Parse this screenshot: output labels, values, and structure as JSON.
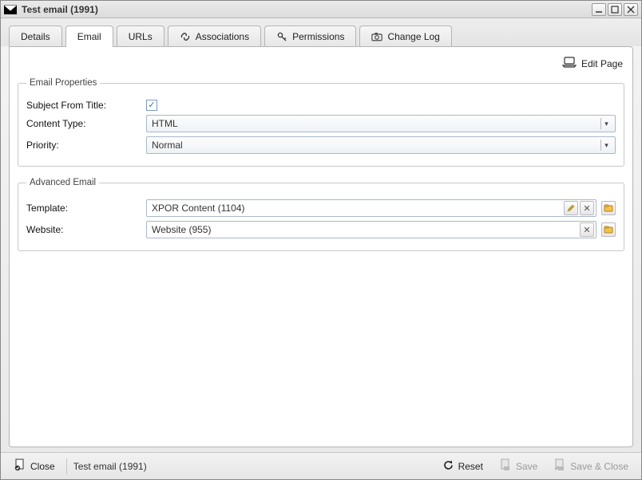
{
  "window": {
    "title": "Test email (1991)"
  },
  "tabs": [
    {
      "label": "Details"
    },
    {
      "label": "Email"
    },
    {
      "label": "URLs"
    },
    {
      "label": "Associations"
    },
    {
      "label": "Permissions"
    },
    {
      "label": "Change Log"
    }
  ],
  "active_tab_index": 1,
  "edit_page_label": "Edit Page",
  "email_properties": {
    "legend": "Email Properties",
    "subject_from_title_label": "Subject From Title:",
    "subject_from_title_checked": true,
    "content_type_label": "Content Type:",
    "content_type_value": "HTML",
    "priority_label": "Priority:",
    "priority_value": "Normal"
  },
  "advanced_email": {
    "legend": "Advanced Email",
    "template_label": "Template:",
    "template_value": "XPOR Content (1104)",
    "website_label": "Website:",
    "website_value": "Website (955)"
  },
  "footer": {
    "close_label": "Close",
    "breadcrumb": "Test email (1991)",
    "reset_label": "Reset",
    "save_label": "Save",
    "save_close_label": "Save & Close"
  }
}
